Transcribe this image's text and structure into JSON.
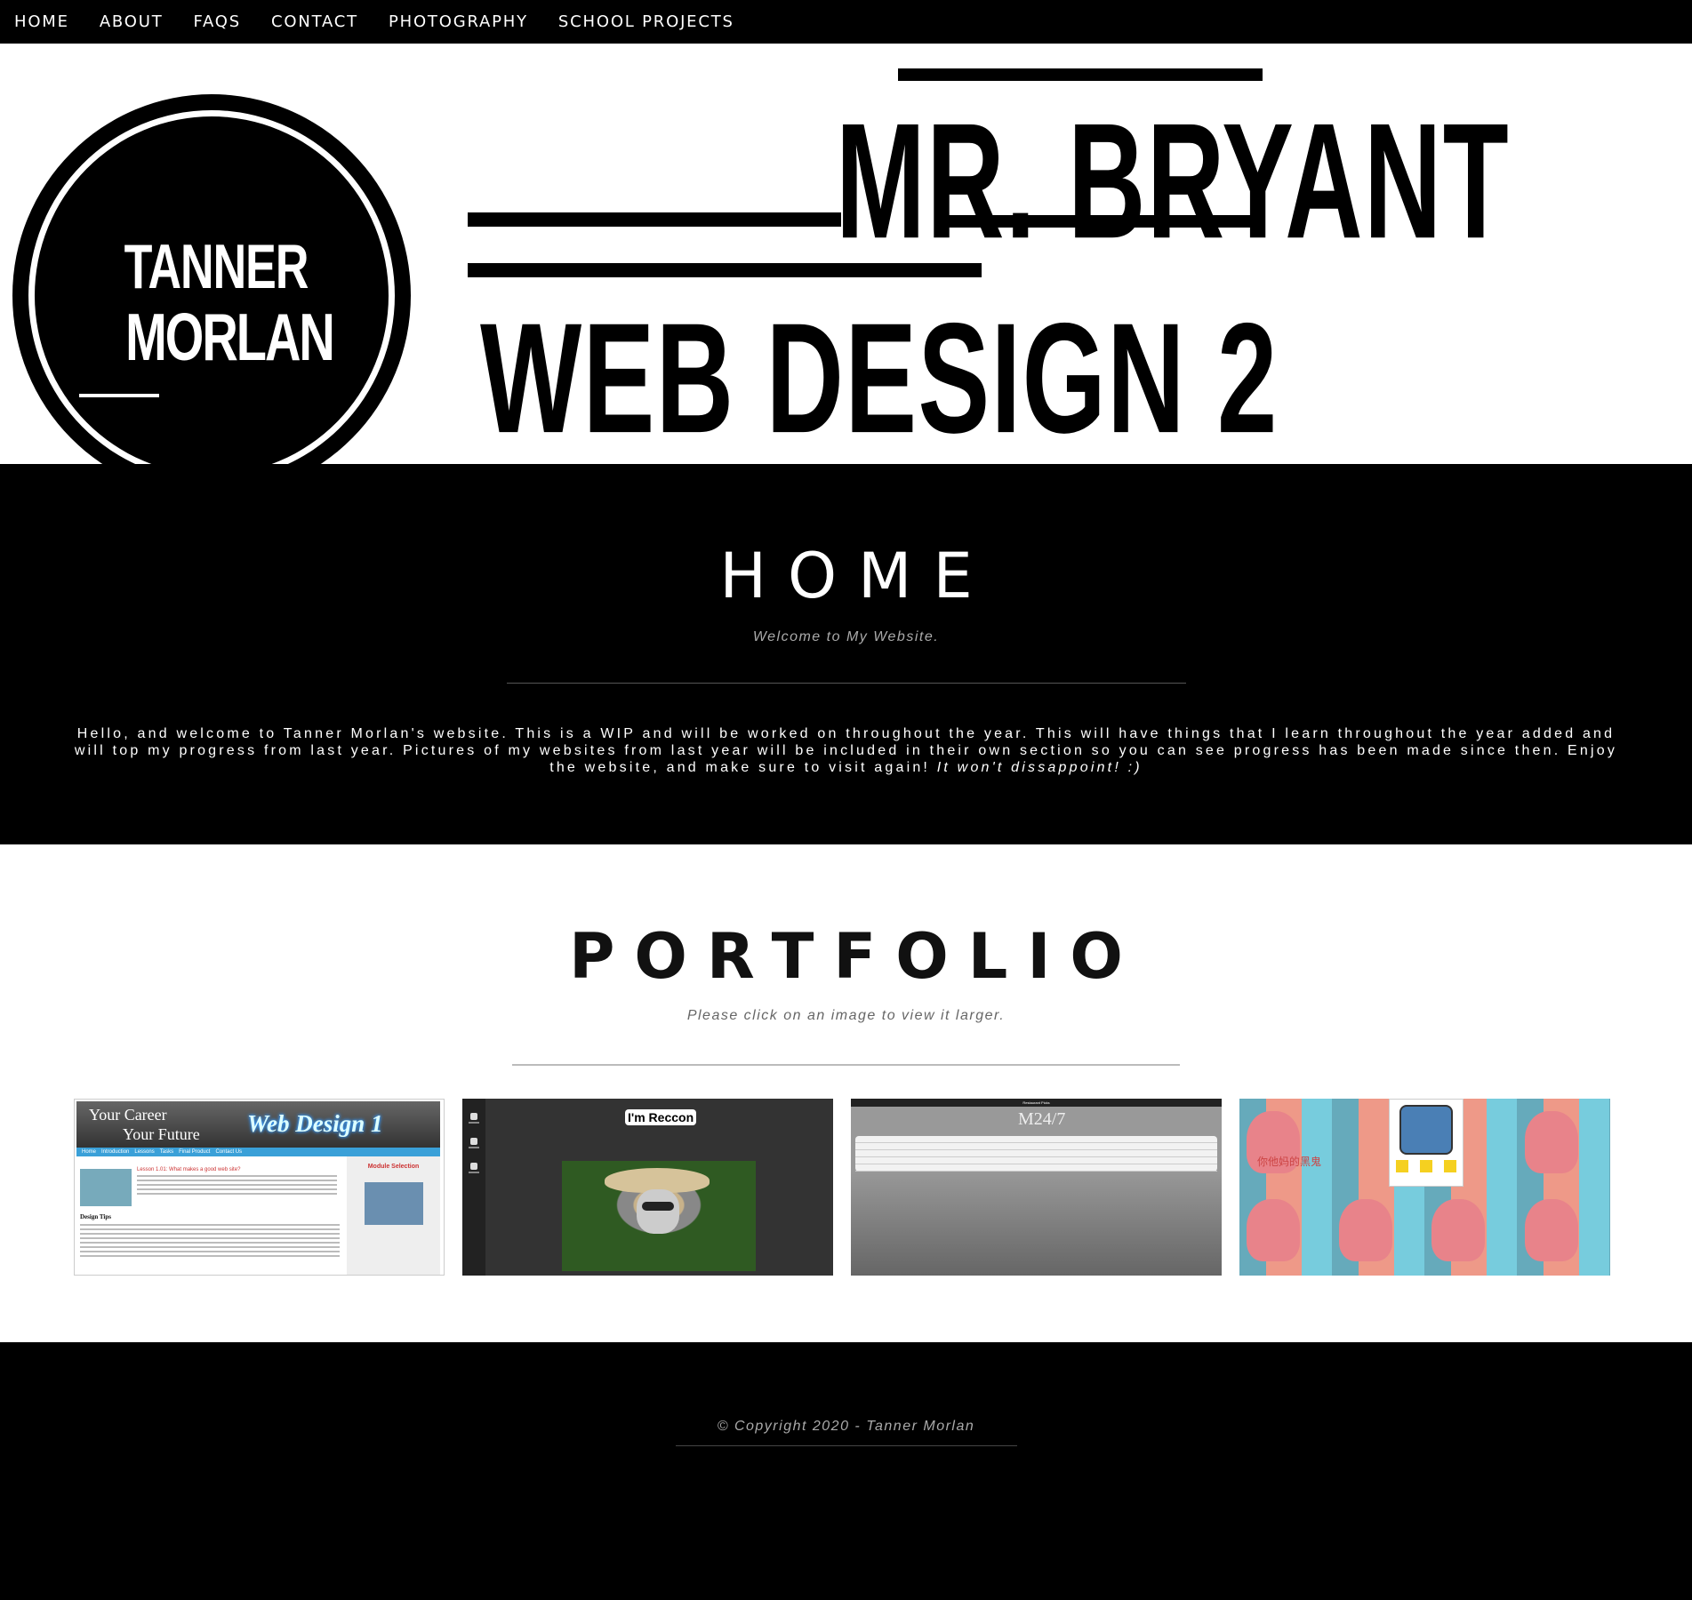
{
  "nav": {
    "items": [
      "HOME",
      "ABOUT",
      "FAQS",
      "CONTACT",
      "PHOTOGRAPHY",
      "SCHOOL PROJECTS"
    ]
  },
  "banner": {
    "logo_line1": "TANNER",
    "logo_line2": "MORLAN",
    "title_line1": "MR. BRYANT",
    "title_line2": "WEB DESIGN 2"
  },
  "home": {
    "title": "HOME",
    "subtitle": "Welcome to My Website.",
    "body": "Hello, and welcome to Tanner Morlan's website. This is a WIP and will be worked on throughout the year. This will have things that I learn throughout the year added and will top my progress from last year. Pictures of my websites from last year will be included in their own section so you can see progress has been made since then. Enjoy the website, and make sure to visit again!",
    "body_emphasis": "It won't dissappoint! :)"
  },
  "portfolio": {
    "title": "PORTFOLIO",
    "subtitle": "Please click on an image to view it larger.",
    "thumbs": [
      {
        "header_line1": "Your Career",
        "header_line2": "Your Future",
        "header_brand": "Web Design 1",
        "nav": [
          "Home",
          "Introduction",
          "Lessons",
          "Tasks",
          "Final Product",
          "Contact Us"
        ],
        "lesson_heading": "Lesson 1.01: What makes a good web site?",
        "section_heading": "Design Tips",
        "sidebar_title": "Module Selection"
      },
      {
        "badge": "I'm Reccon"
      },
      {
        "logo": "M24/7",
        "top_bar": "Restaurant Picks"
      },
      {
        "caption": "你他妈的黑鬼"
      }
    ]
  },
  "footer": {
    "copyright": "© Copyright 2020 - Tanner Morlan"
  },
  "colors": {
    "nav_bg": "#000000",
    "section_dark": "#000000",
    "section_light": "#ffffff",
    "muted_text": "#aaaaaa"
  }
}
